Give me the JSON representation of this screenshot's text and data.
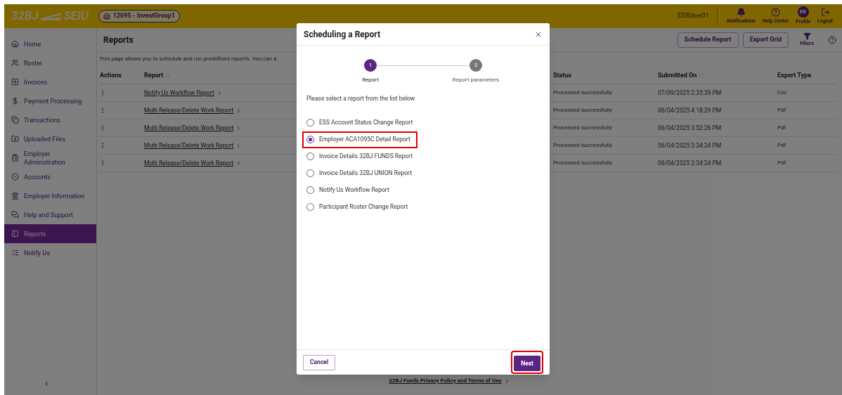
{
  "header": {
    "logo": [
      "32BJ",
      "SEIU"
    ],
    "group": "12695 - InvestGroup1",
    "user": "ESSUser01",
    "actions": [
      {
        "label": "Notifications"
      },
      {
        "label": "Help Center"
      },
      {
        "label": "Profile",
        "initials": "EE"
      },
      {
        "label": "Logout"
      }
    ]
  },
  "sidebar": {
    "items": [
      {
        "label": "Home",
        "selected": false
      },
      {
        "label": "Roster",
        "selected": false
      },
      {
        "label": "Invoices",
        "selected": false
      },
      {
        "label": "Payment Processing",
        "selected": false
      },
      {
        "label": "Transactions",
        "selected": false
      },
      {
        "label": "Uploaded Files",
        "selected": false
      },
      {
        "label": "Employer Administration",
        "selected": false
      },
      {
        "label": "Accounts",
        "selected": false
      },
      {
        "label": "Employer Information",
        "selected": false
      },
      {
        "label": "Help and Support",
        "selected": false
      },
      {
        "label": "Reports",
        "selected": true
      },
      {
        "label": "Notify Us",
        "selected": false
      }
    ],
    "collapse": "‹"
  },
  "page": {
    "title": "Reports",
    "description": "This page allows you to schedule and run predefined reports. You can a",
    "buttons": [
      "Schedule Report",
      "Export Grid"
    ],
    "filters_label": "Filters"
  },
  "table": {
    "columns": [
      {
        "label": "Actions",
        "sortable": false
      },
      {
        "label": "Report",
        "sortable": true
      },
      {
        "label": "Status",
        "sortable": false
      },
      {
        "label": "Submitted On",
        "sortable": true
      },
      {
        "label": "Export Type",
        "sortable": false
      }
    ],
    "rows": [
      {
        "report": "Notify Us Workflow Report",
        "status": "Processed successfully",
        "submitted_on": "07/09/2025 2:35:39 PM",
        "export_type": "Csv"
      },
      {
        "report": "Multi Release/Delete Work Report",
        "status": "Processed successfully",
        "submitted_on": "06/04/2025 4:18:29 PM",
        "export_type": "Pdf"
      },
      {
        "report": "Multi Release/Delete Work Report",
        "status": "Processed successfully",
        "submitted_on": "06/04/2025 3:52:26 PM",
        "export_type": "Pdf"
      },
      {
        "report": "Multi Release/Delete Work Report",
        "status": "Processed successfully",
        "submitted_on": "06/04/2025 3:34:24 PM",
        "export_type": "Pdf"
      },
      {
        "report": "Multi Release/Delete Work Report",
        "status": "Processed successfully",
        "submitted_on": "06/04/2025 3:34:24 PM",
        "export_type": "Pdf"
      }
    ]
  },
  "footer_link": "32BJ Funds Privacy Policy and Terms of Use",
  "dialog": {
    "title": "Scheduling a Report",
    "steps": [
      {
        "number": "1",
        "label": "Report",
        "selected": true
      },
      {
        "number": "2",
        "label": "Report parameters",
        "selected": false
      }
    ],
    "instruction": "Please select a report from the list below",
    "options": [
      {
        "label": "ESS Account Status Change Report",
        "selected": false,
        "highlighted": false
      },
      {
        "label": "Employer ACA1095C Detail Report",
        "selected": true,
        "highlighted": true
      },
      {
        "label": "Invoice Details 32BJ FUNDS Report",
        "selected": false,
        "highlighted": false
      },
      {
        "label": "Invoice Details 32BJ UNION Report",
        "selected": false,
        "highlighted": false
      },
      {
        "label": "Notify Us Workflow Report",
        "selected": false,
        "highlighted": false
      },
      {
        "label": "Participant Roster Change Report",
        "selected": false,
        "highlighted": false
      }
    ],
    "cancel": "Cancel",
    "next": {
      "label": "Next",
      "highlighted": true
    }
  }
}
